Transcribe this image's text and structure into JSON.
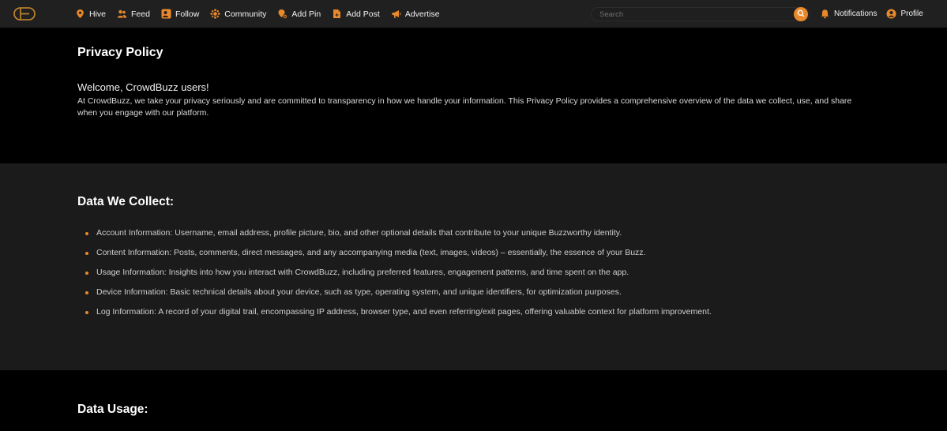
{
  "nav": {
    "logo": "CB",
    "items": [
      {
        "label": "Hive",
        "icon": "location-pin-icon"
      },
      {
        "label": "Feed",
        "icon": "people-icon"
      },
      {
        "label": "Follow",
        "icon": "follow-icon"
      },
      {
        "label": "Community",
        "icon": "community-icon"
      },
      {
        "label": "Add Pin",
        "icon": "add-pin-icon"
      },
      {
        "label": "Add Post",
        "icon": "add-post-icon"
      },
      {
        "label": "Advertise",
        "icon": "megaphone-icon"
      }
    ],
    "search_placeholder": "Search",
    "notifications": "Notifications",
    "profile": "Profile",
    "accent_color": "#e8892c"
  },
  "policy": {
    "title": "Privacy Policy",
    "welcome": "Welcome, CrowdBuzz users!",
    "intro": "At CrowdBuzz, we take your privacy seriously and are committed to transparency in how we handle your information. This Privacy Policy provides a comprehensive overview of the data we collect, use, and share when you engage with our platform."
  },
  "collect": {
    "heading": "Data We Collect:",
    "items": [
      "Account Information: Username, email address, profile picture, bio, and other optional details that contribute to your unique Buzzworthy identity.",
      "Content Information: Posts, comments, direct messages, and any accompanying media (text, images, videos) – essentially, the essence of your Buzz.",
      "Usage Information: Insights into how you interact with CrowdBuzz, including preferred features, engagement patterns, and time spent on the app.",
      "Device Information: Basic technical details about your device, such as type, operating system, and unique identifiers, for optimization purposes.",
      "Log Information: A record of your digital trail, encompassing IP address, browser type, and even referring/exit pages, offering valuable context for platform improvement."
    ]
  },
  "usage": {
    "heading": "Data Usage:"
  }
}
